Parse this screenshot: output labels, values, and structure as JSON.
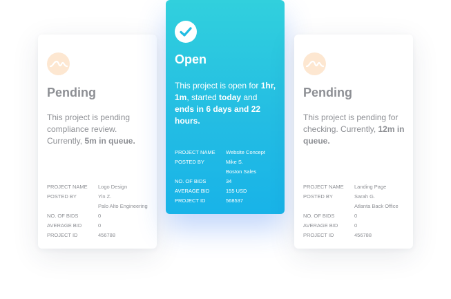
{
  "cards": [
    {
      "status": "Pending",
      "icon": "wave-icon",
      "desc_parts": [
        "This project is pending compliance review. Currently, ",
        "5m in queue."
      ],
      "meta": {
        "project_name_label": "PROJECT NAME",
        "project_name": "Logo Design",
        "posted_by_label": "POSTED BY",
        "posted_by": "Yin Z.",
        "company": "Palo Alto Engineering",
        "bids_label": "NO. OF BIDS",
        "bids": "0",
        "avg_bid_label": "AVERAGE BID",
        "avg_bid": "0",
        "project_id_label": "PROJECT ID",
        "project_id": "456788"
      }
    },
    {
      "status": "Open",
      "icon": "check-icon",
      "desc_parts": [
        "This project is open for ",
        "1hr, 1m",
        ", started ",
        "today",
        " and ",
        "ends in 6 days and 22 hours."
      ],
      "meta": {
        "project_name_label": "PROJECT NAME",
        "project_name": "Website Concept",
        "posted_by_label": "POSTED BY",
        "posted_by": "Mike S.",
        "company": "Boston Sales",
        "bids_label": "NO. OF BIDS",
        "bids": "34",
        "avg_bid_label": "AVERAGE BID",
        "avg_bid": "155 USD",
        "project_id_label": "PROJECT ID",
        "project_id": "568537"
      }
    },
    {
      "status": "Pending",
      "icon": "wave-icon",
      "desc_parts": [
        "This project is pending for checking. Currently, ",
        "12m in queue."
      ],
      "meta": {
        "project_name_label": "PROJECT NAME",
        "project_name": "Landing Page",
        "posted_by_label": "POSTED BY",
        "posted_by": "Sarah G.",
        "company": "Atlanta Back Office",
        "bids_label": "NO. OF BIDS",
        "bids": "0",
        "avg_bid_label": "AVERAGE BID",
        "avg_bid": "0",
        "project_id_label": "PROJECT ID",
        "project_id": "456788"
      }
    }
  ],
  "colors": {
    "open_gradient_top": "#31d0dd",
    "open_gradient_bottom": "#18b3e8",
    "pending_icon_bg": "#fde7d1",
    "pending_icon_fg": "#f6b87c",
    "pending_text": "#8d8f94"
  }
}
